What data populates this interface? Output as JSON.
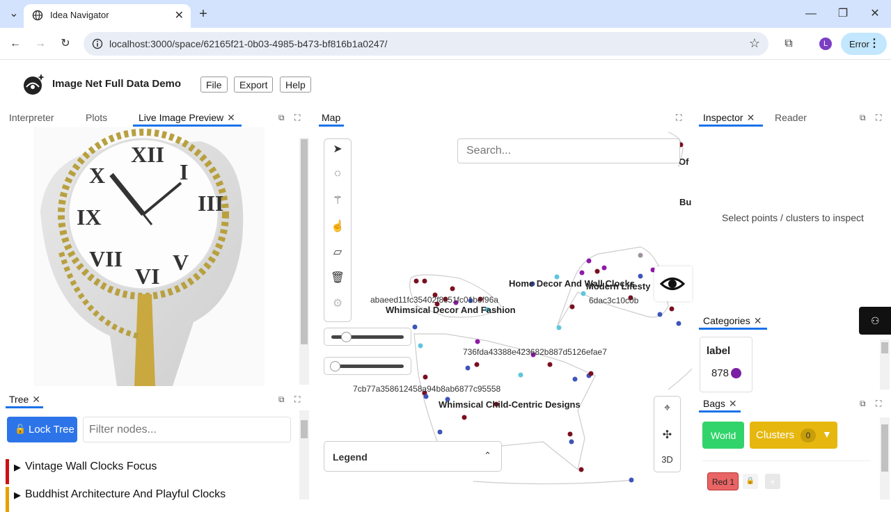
{
  "browser": {
    "tab_title": "Idea Navigator",
    "url": "localhost:3000/space/62165f21-0b03-4985-b473-bf816b1a0247/",
    "error_label": "Error",
    "avatar_letter": "L"
  },
  "app": {
    "title": "Image Net Full Data Demo",
    "menu": [
      "File",
      "Export",
      "Help"
    ]
  },
  "left_panel": {
    "tabs": [
      "Interpreter",
      "Plots",
      "Live Image Preview"
    ]
  },
  "tree": {
    "tab": "Tree",
    "lock_label": "Lock Tree",
    "filter_placeholder": "Filter nodes...",
    "items": [
      {
        "label": "Vintage Wall Clocks Focus",
        "color": "#cc1111"
      },
      {
        "label": "Buddhist Architecture And Playful Clocks",
        "color": "#e8a000"
      }
    ]
  },
  "map": {
    "tab": "Map",
    "search_placeholder": "Search...",
    "legend_label": "Legend",
    "nav_3d": "3D",
    "labels": [
      "Whimsical Decor And Fashion",
      "Home Decor And Wall Clocks",
      "Modern Lifesty",
      "Whimsical Child-Centric Designs",
      "Of",
      "Bu"
    ],
    "hashes": [
      "abaeed11fc35402f8c51fc01bef96a",
      "6dac3c10c0b",
      "736fda43388e423682b887d5126efae7",
      "7cb77a358612458a94b8ab6877c95558"
    ]
  },
  "inspector": {
    "tabs": [
      "Inspector",
      "Reader"
    ],
    "empty_text": "Select points / clusters to inspect"
  },
  "categories": {
    "tab": "Categories",
    "header": "label",
    "value": "878"
  },
  "bags": {
    "tab": "Bags",
    "world_label": "World",
    "clusters_label": "Clusters",
    "clusters_count": "0",
    "red_label": "Red 1"
  }
}
